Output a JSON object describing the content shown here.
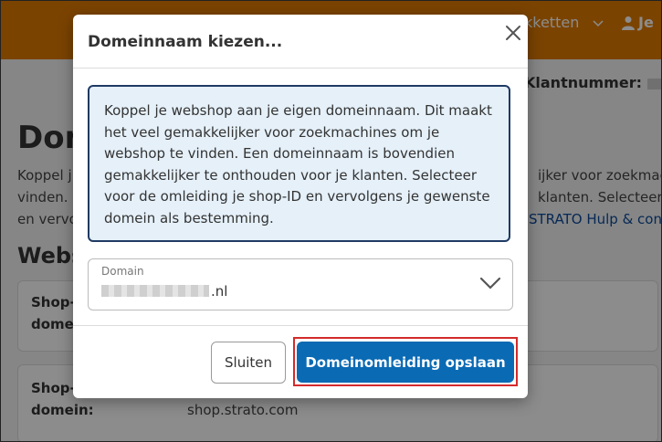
{
  "background": {
    "nav": {
      "pakketten": "kketten",
      "user": "Je"
    },
    "klantnummer_label": "Klantnummer:",
    "page_heading": "Don",
    "page_text": {
      "line1": "Koppel j",
      "line1_right": "ijker voor zoekmach",
      "line2": "vinden. ",
      "line2_right": "klanten. Selecteer v",
      "line3": "en vervo",
      "line3_link": "STRATO Hulp & con"
    },
    "websection_heading": "Webs",
    "cards": [
      {
        "label_line1": "Shop-",
        "label_line2": "domei"
      },
      {
        "label_line1": "Shop-",
        "label_line2": "domein:",
        "value": "shop.strato.com"
      }
    ]
  },
  "modal": {
    "title": "Domeinnaam kiezen...",
    "info_text": "Koppel je webshop aan je eigen domeinnaam. Dit maakt het veel gemakkelijker voor zoekmachines om je webshop te vinden. Een domeinnaam is bovendien gemakkelijker te onthouden voor je klanten. Selecteer voor de omleiding je shop-ID en vervolgens je gewenste domein als bestemming.",
    "domain_select": {
      "label": "Domain",
      "value_suffix": ".nl"
    },
    "buttons": {
      "close": "Sluiten",
      "save": "Domeinomleiding opslaan"
    }
  },
  "colors": {
    "brand_orange": "#e07b00",
    "primary_blue": "#0a6ab4",
    "info_bg": "#e5f0f9",
    "info_border": "#1f3a63",
    "highlight_red": "#d42b2b"
  },
  "icons": [
    "user-icon",
    "chevron-down-icon",
    "close-icon"
  ]
}
